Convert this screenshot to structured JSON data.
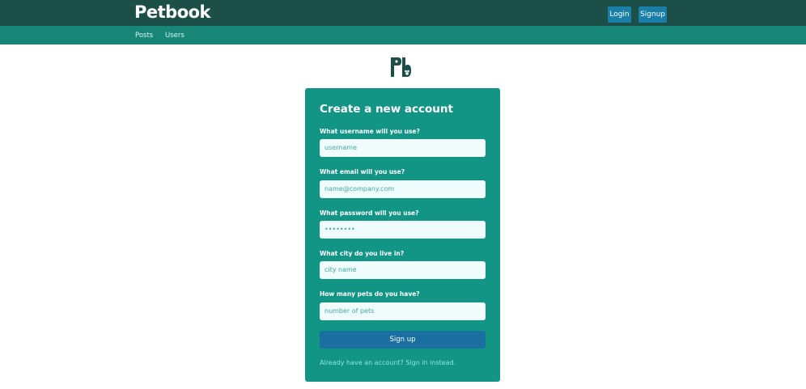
{
  "header": {
    "logo_text": "Petbook",
    "login_label": "Login",
    "signup_label": "Signup"
  },
  "subnav": {
    "posts_label": "Posts",
    "users_label": "Users"
  },
  "brand_mark": "Pb",
  "form": {
    "title": "Create a new account",
    "username_label": "What username will you use?",
    "username_placeholder": "username",
    "email_label": "What email will you use?",
    "email_placeholder": "name@company.com",
    "password_label": "What password will you use?",
    "password_value": "••••••••",
    "city_label": "What city do you live in?",
    "city_placeholder": "city name",
    "pets_label": "How many pets do you have?",
    "pets_placeholder": "number of pets",
    "submit_label": "Sign up",
    "signin_text": "Already have an account? Sign in instead."
  },
  "colors": {
    "topbar": "#1b4f48",
    "subnav": "#178677",
    "card": "#139586",
    "button": "#1a6fa0",
    "input_bg": "#effcfb"
  }
}
